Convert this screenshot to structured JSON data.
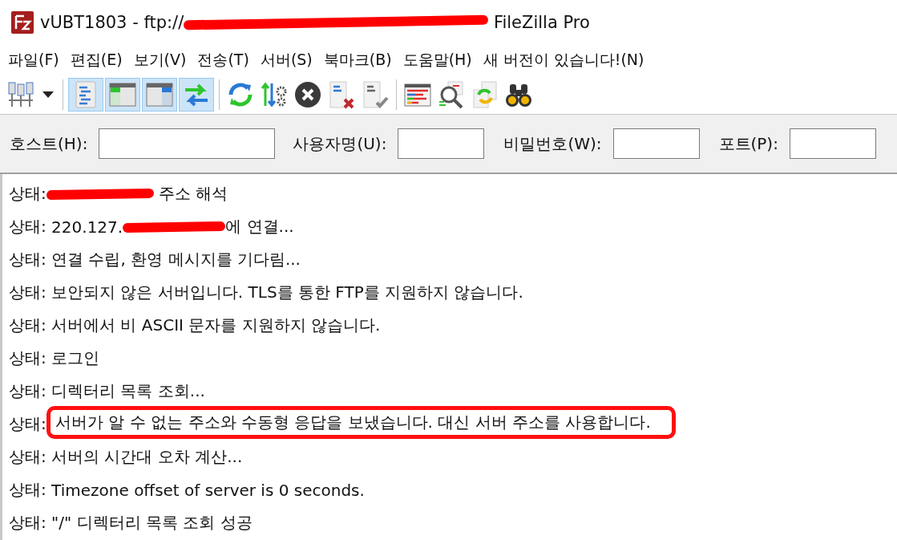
{
  "window": {
    "title_before": "vUBT1803 - ftp://",
    "title_redacted": true,
    "title_after": "FileZilla Pro"
  },
  "menu": [
    {
      "label": "파일(F)"
    },
    {
      "label": "편집(E)"
    },
    {
      "label": "보기(V)"
    },
    {
      "label": "전송(T)"
    },
    {
      "label": "서버(S)"
    },
    {
      "label": "북마크(B)"
    },
    {
      "label": "도움말(H)"
    },
    {
      "label": "새 버전이 있습니다!(N)"
    }
  ],
  "toolbar": [
    {
      "kind": "site-manager",
      "on": false
    },
    {
      "kind": "dropdown",
      "on": false
    },
    {
      "kind": "log",
      "on": true
    },
    {
      "kind": "local-tree",
      "on": true
    },
    {
      "kind": "remote-tree",
      "on": true
    },
    {
      "kind": "transfer-queue",
      "on": true
    },
    {
      "kind": "refresh",
      "on": false
    },
    {
      "kind": "filters",
      "on": false
    },
    {
      "kind": "cancel",
      "on": false
    },
    {
      "kind": "disconnect",
      "on": false
    },
    {
      "kind": "reconnect",
      "on": false
    },
    {
      "kind": "compare",
      "on": false
    },
    {
      "kind": "search",
      "on": false
    },
    {
      "kind": "sync",
      "on": false
    },
    {
      "kind": "find",
      "on": false
    }
  ],
  "quickconnect": [
    {
      "label": "호스트(H):",
      "kind": "host"
    },
    {
      "label": "사용자명(U):",
      "kind": "user"
    },
    {
      "label": "비밀번호(W):",
      "kind": "password"
    },
    {
      "label": "포트(P):",
      "kind": "port"
    }
  ],
  "log": [
    {
      "label": "상태:",
      "redacted": true,
      "after": " 주소 해석",
      "highlighted": false
    },
    {
      "label": "상태:",
      "before": " 220.127.",
      "redacted": true,
      "after": "에 연결...",
      "highlighted": false
    },
    {
      "label": "상태:",
      "before": " 연결 수립, 환영 메시지를 기다림...",
      "redacted": false,
      "highlighted": false
    },
    {
      "label": "상태:",
      "before": " 보안되지 않은 서버입니다. TLS를 통한 FTP를 지원하지 않습니다.",
      "redacted": false,
      "highlighted": false
    },
    {
      "label": "상태:",
      "before": " 서버에서 비 ASCII 문자를 지원하지 않습니다.",
      "redacted": false,
      "highlighted": false
    },
    {
      "label": "상태:",
      "before": " 로그인",
      "redacted": false,
      "highlighted": false
    },
    {
      "label": "상태:",
      "before": " 디렉터리 목록 조회...",
      "redacted": false,
      "highlighted": false
    },
    {
      "label": "상태:",
      "before": " 서버가 알 수 없는 주소와 수동형 응답을 보냈습니다. 대신 서버 주소를 사용합니다.",
      "redacted": false,
      "highlighted": true
    },
    {
      "label": "상태:",
      "before": " 서버의 시간대 오차 계산...",
      "redacted": false,
      "highlighted": false
    },
    {
      "label": "상태:",
      "before": " Timezone offset of server is 0 seconds.",
      "redacted": false,
      "highlighted": false
    },
    {
      "label": "상태:",
      "before": " \"/\" 디렉터리 목록 조회 성공",
      "redacted": false,
      "highlighted": false
    }
  ]
}
